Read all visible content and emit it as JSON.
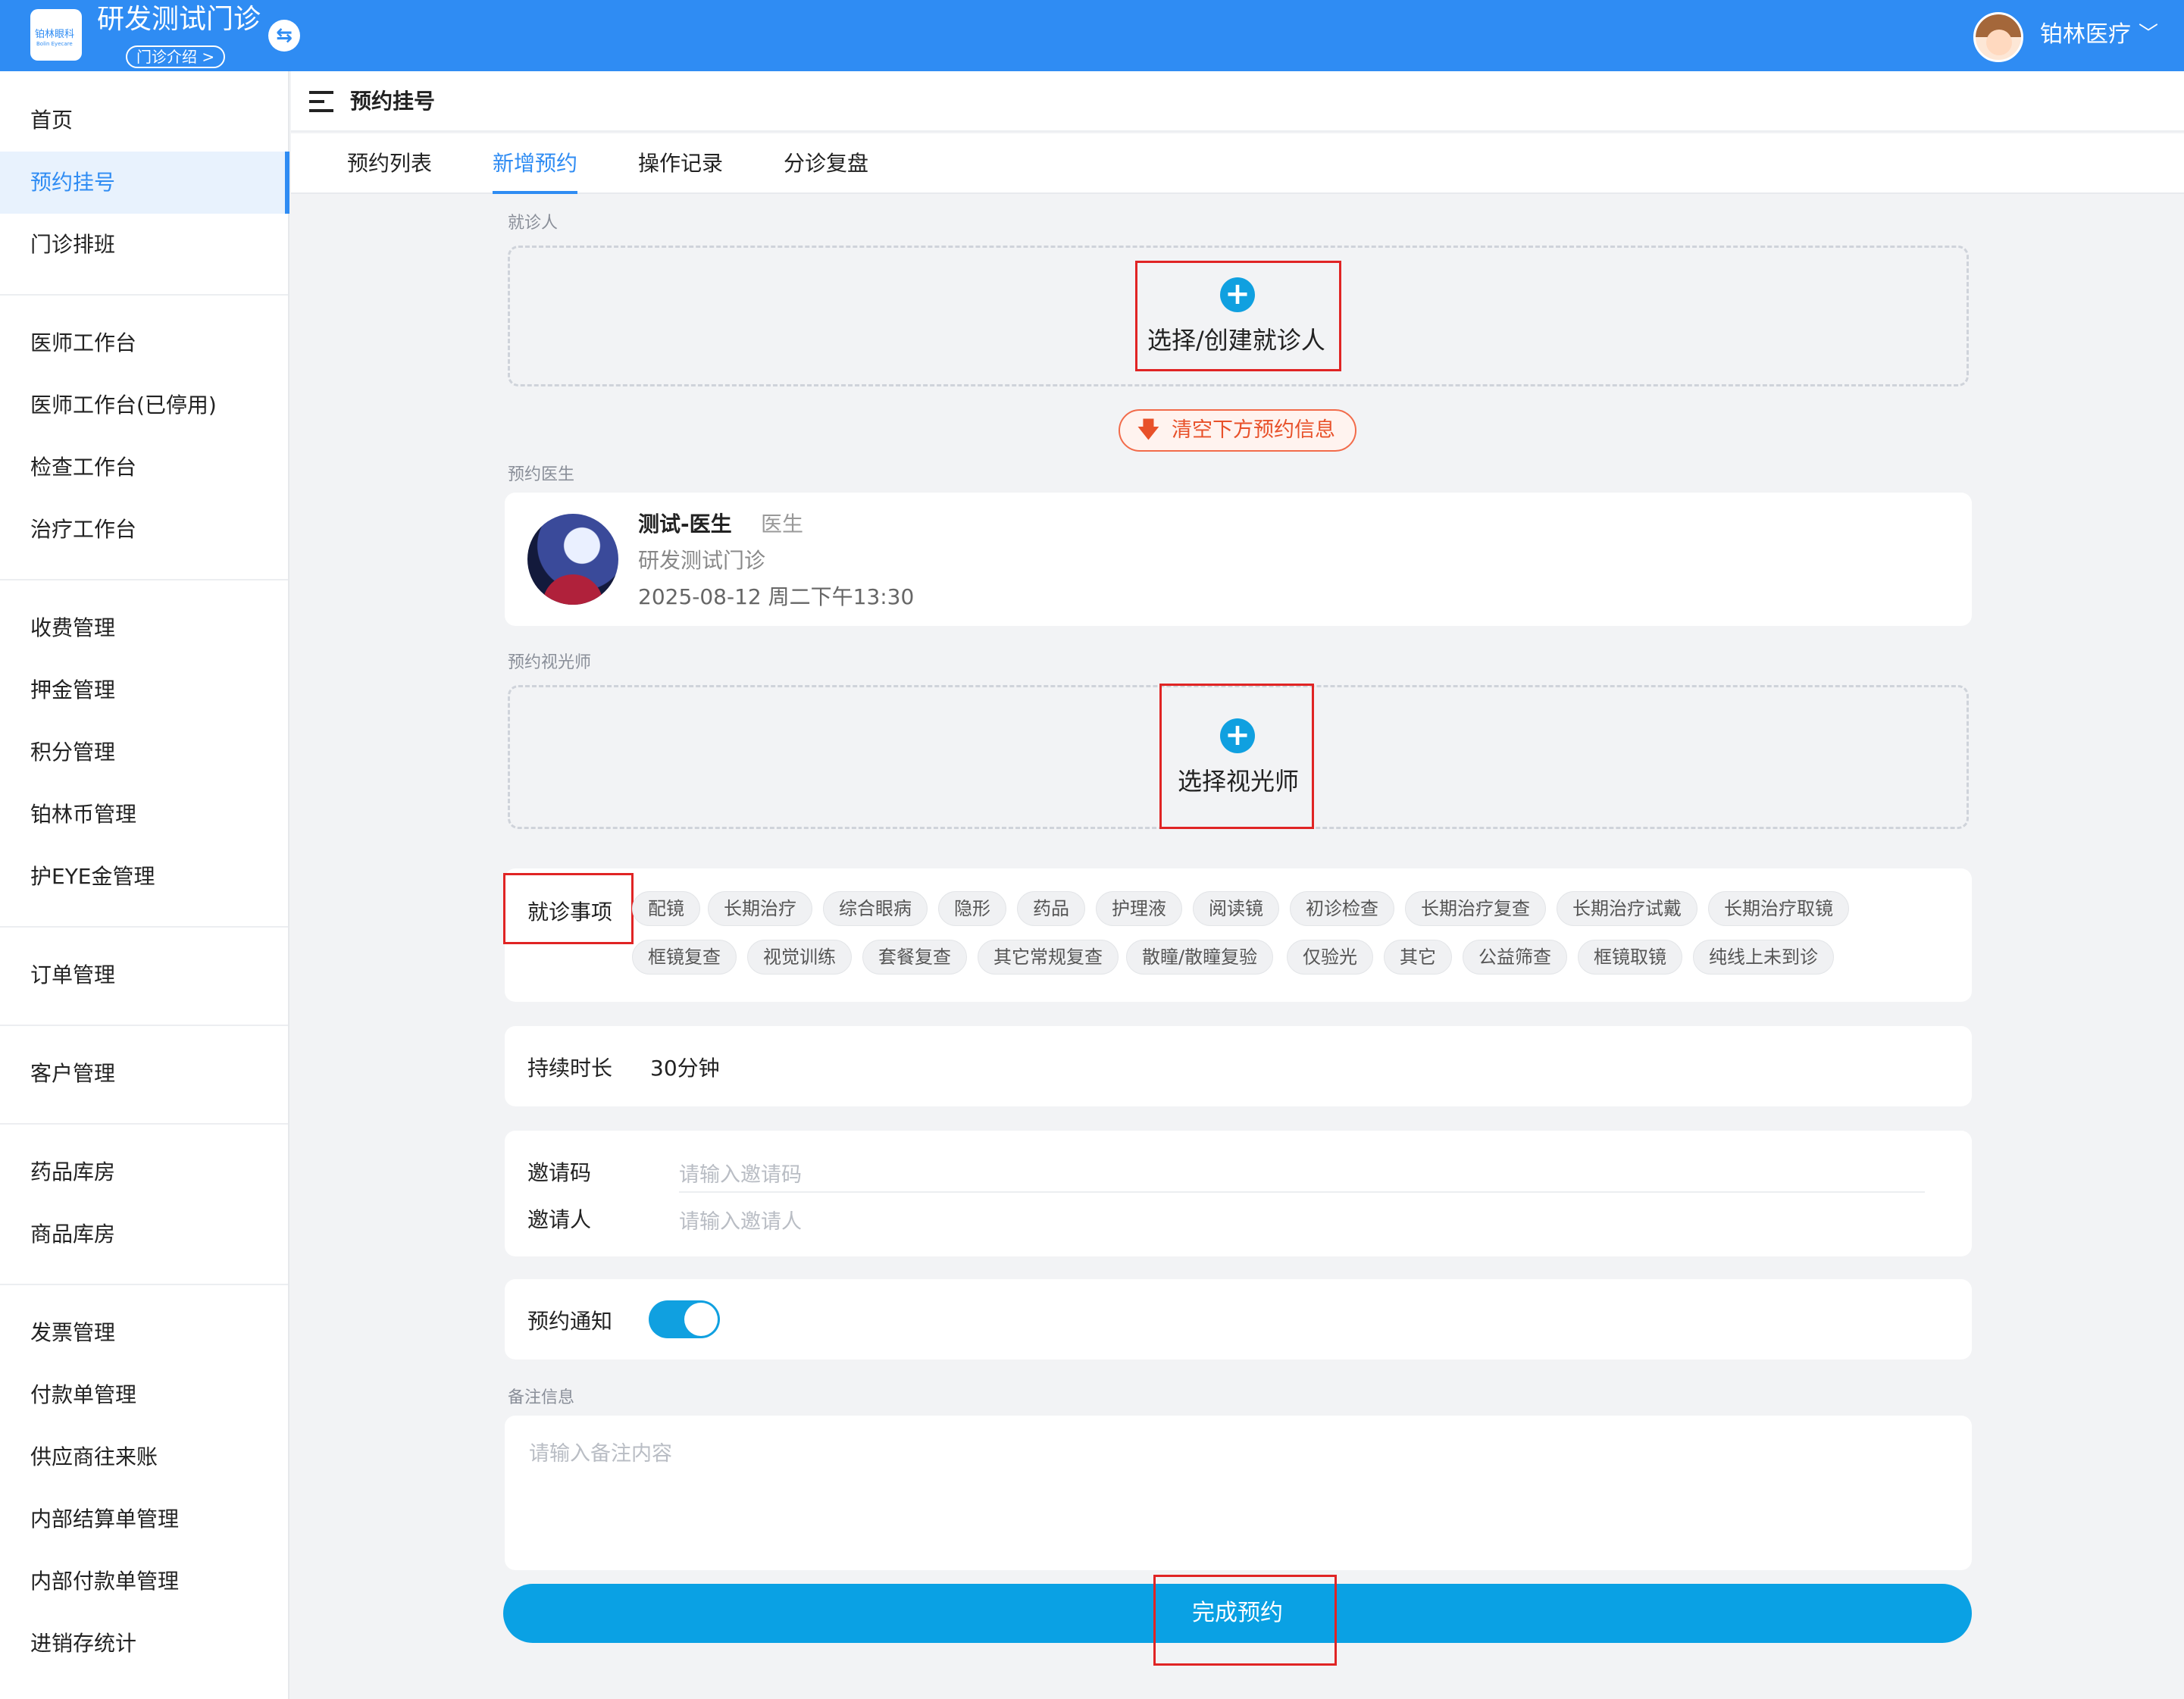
{
  "header": {
    "logo_text": "铂林眼科",
    "logo_sub": "Bolin Eyecare",
    "clinic_name": "研发测试门诊",
    "clinic_intro": "门诊介绍 >",
    "user_name": "铂林医疗"
  },
  "sidebar": {
    "items": [
      {
        "label": "首页"
      },
      {
        "label": "预约挂号"
      },
      {
        "label": "门诊排班"
      },
      {
        "label": "医师工作台"
      },
      {
        "label": "医师工作台(已停用)"
      },
      {
        "label": "检查工作台"
      },
      {
        "label": "治疗工作台"
      },
      {
        "label": "收费管理"
      },
      {
        "label": "押金管理"
      },
      {
        "label": "积分管理"
      },
      {
        "label": "铂林币管理"
      },
      {
        "label": "护EYE金管理"
      },
      {
        "label": "订单管理"
      },
      {
        "label": "客户管理"
      },
      {
        "label": "药品库房"
      },
      {
        "label": "商品库房"
      },
      {
        "label": "发票管理"
      },
      {
        "label": "付款单管理"
      },
      {
        "label": "供应商往来账"
      },
      {
        "label": "内部结算单管理"
      },
      {
        "label": "内部付款单管理"
      },
      {
        "label": "进销存统计"
      }
    ]
  },
  "page": {
    "title": "预约挂号",
    "tabs": [
      {
        "label": "预约列表"
      },
      {
        "label": "新增预约"
      },
      {
        "label": "操作记录"
      },
      {
        "label": "分诊复盘"
      }
    ]
  },
  "form": {
    "patient_label": "就诊人",
    "patient_action": "选择/创建就诊人",
    "clear_label": "清空下方预约信息",
    "doctor_label": "预约医生",
    "doctor": {
      "name": "测试-医生",
      "title": "医生",
      "clinic": "研发测试门诊",
      "time": "2025-08-12 周二下午13:30"
    },
    "optometrist_label": "预约视光师",
    "optometrist_action": "选择视光师",
    "items_label": "就诊事项",
    "items": [
      "配镜",
      "长期治疗",
      "综合眼病",
      "隐形",
      "药品",
      "护理液",
      "阅读镜",
      "初诊检查",
      "长期治疗复查",
      "长期治疗试戴",
      "长期治疗取镜",
      "框镜复查",
      "视觉训练",
      "套餐复查",
      "其它常规复查",
      "散瞳/散瞳复验",
      "仅验光",
      "其它",
      "公益筛查",
      "框镜取镜",
      "纯线上未到诊"
    ],
    "duration_label": "持续时长",
    "duration_value": "30分钟",
    "invite_code_label": "邀请码",
    "invite_code_placeholder": "请输入邀请码",
    "inviter_label": "邀请人",
    "inviter_placeholder": "请输入邀请人",
    "notify_label": "预约通知",
    "notify_on": true,
    "remark_label": "备注信息",
    "remark_placeholder": "请输入备注内容",
    "submit_label": "完成预约"
  },
  "colors": {
    "primary": "#2f8cf3",
    "accent": "#0aa1e4",
    "highlight_box": "#e02424",
    "clear_button": "#e8512a"
  }
}
